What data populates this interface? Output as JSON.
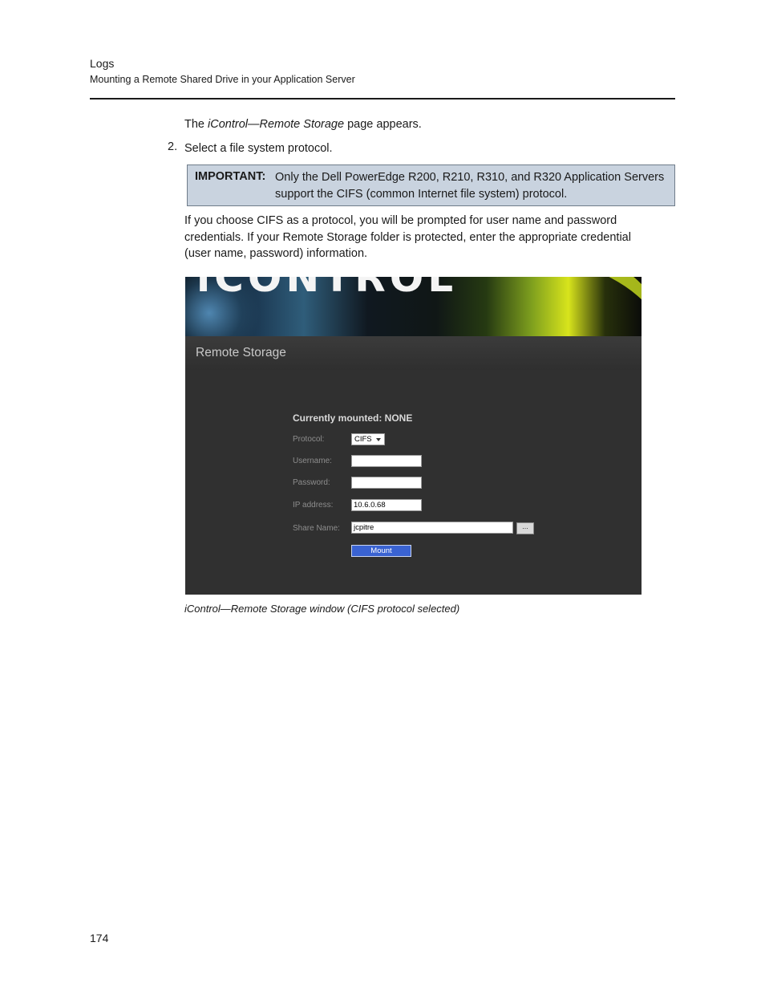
{
  "header": {
    "section": "Logs",
    "subtitle": "Mounting a Remote Shared Drive in your Application Server"
  },
  "body": {
    "intro_prefix": "The ",
    "intro_title": "iControl—Remote Storage",
    "intro_suffix": " page appears.",
    "step_number": "2.",
    "step_text": "Select a file system protocol.",
    "important_label": "IMPORTANT:",
    "important_text": "Only the Dell PowerEdge R200, R210, R310, and R320 Application Servers support the CIFS (common Internet file system) protocol.",
    "para_lines": [
      "If you choose CIFS as a protocol, you will be prompted for user name and password",
      "credentials. If your Remote Storage folder is protected, enter the appropriate credential",
      "(user name, password) information."
    ]
  },
  "screenshot": {
    "logo": "iCONTROL",
    "title": "Remote Storage",
    "mounted": "Currently mounted: NONE",
    "labels": {
      "protocol": "Protocol:",
      "username": "Username:",
      "password": "Password:",
      "ip": "IP address:",
      "share": "Share Name:"
    },
    "values": {
      "protocol": "CIFS",
      "username": "",
      "password": "",
      "ip": "10.6.0.68",
      "share": "jcpitre"
    },
    "browse_label": "...",
    "mount_label": "Mount"
  },
  "caption": "iControl—Remote Storage window (CIFS protocol selected)",
  "page_number": "174",
  "colors": {
    "important_bg": "#c9d3df",
    "panel_bg": "#303030",
    "mount_button": "#3a63d2"
  }
}
